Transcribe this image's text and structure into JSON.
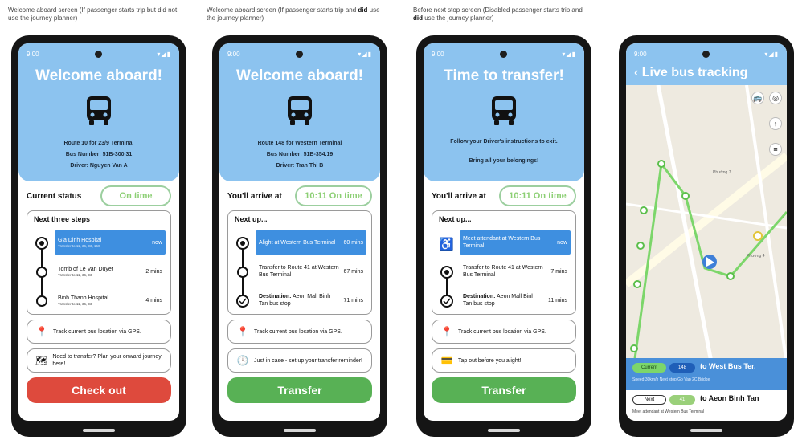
{
  "captions": [
    {
      "pre": "Welcome aboard screen (If passenger starts trip but did ",
      "bold": "",
      "post": "not use the journey planner)"
    },
    {
      "pre": "Welcome aboard screen (If passenger starts trip and ",
      "bold": "did",
      "post": " use the journey planner)"
    },
    {
      "pre": "Before next stop screen (Disabled passenger starts trip and ",
      "bold": "did",
      "post": " use the journey planner)"
    }
  ],
  "status_bar": {
    "time": "9:00",
    "icons": "▾◢▮"
  },
  "screen1": {
    "title": "Welcome aboard!",
    "route": "Route 10 for 23/9 Terminal",
    "bus_number": "Bus Number: 51B-300.31",
    "driver": "Driver: Nguyen Van A",
    "status_label": "Current status",
    "status_value": "On time",
    "card_title": "Next three steps",
    "stops": [
      {
        "name": "Gia Dinh Hospital",
        "sub": "Transfer to 11, 36, 93, 150",
        "eta": "now"
      },
      {
        "name": "Tomb of Le Van Duyet",
        "sub": "Transfer to 11, 36, 93",
        "eta": "2 mins"
      },
      {
        "name": "Binh Thanh Hospital",
        "sub": "Transfer to 11, 36, 93",
        "eta": "4 mins"
      }
    ],
    "track_text": "Track current bus location via GPS.",
    "transfer_text": "Need to transfer? Plan your onward journey here!",
    "checkout_label": "Check out"
  },
  "screen2": {
    "title": "Welcome aboard!",
    "route": "Route 148 for Western Terminal",
    "bus_number": "Bus Number: 51B-354.19",
    "driver": "Driver: Tran Thi B",
    "arrive_label": "You'll arrive at",
    "arrive_value": "10:11 On time",
    "card_title": "Next up...",
    "steps": [
      {
        "name": "Alight at Western Bus Terminal",
        "eta": "60 mins"
      },
      {
        "name": "Transfer to Route 41 at Western Bus Terminal",
        "eta": "67 mins"
      },
      {
        "name_bold": "Destination:",
        "name": " Aeon Mall Binh Tan bus stop",
        "eta": "71 mins"
      }
    ],
    "track_text": "Track current bus location via GPS.",
    "reminder_text": "Just in case - set up your transfer reminder!",
    "button_label": "Transfer"
  },
  "screen3": {
    "title": "Time to transfer!",
    "line1": "Follow your Driver's instructions to exit.",
    "line2": "Bring all your belongings!",
    "arrive_label": "You'll arrive at",
    "arrive_value": "10:11 On time",
    "card_title": "Next up...",
    "steps": [
      {
        "name": "Meet attendant at Western Bus Terminal",
        "eta": "now"
      },
      {
        "name": "Transfer to Route 41 at Western Bus Terminal",
        "eta": "7 mins"
      },
      {
        "name_bold": "Destination:",
        "name": " Aeon Mall Binh Tan bus stop",
        "eta": "11 mins"
      }
    ],
    "track_text": "Track current bus location via GPS.",
    "tap_text": "Tap out before you alight!",
    "button_label": "Transfer"
  },
  "screen4": {
    "title": "Live bus tracking",
    "panel": {
      "current_label": "Current",
      "route": "148",
      "dest": "to West Bus Ter.",
      "sub": "Speed 30km/h Next stop Go Vap 2C Bridge"
    },
    "next": {
      "label": "Next",
      "route": "41",
      "dest": "to Aeon Binh Tan",
      "sub": "Meet attendant at Western Bus Terminal"
    },
    "map_labels": [
      "Phường 7",
      "Phường 4"
    ]
  },
  "colors": {
    "header_blue": "#8cc3ef",
    "highlight_blue": "#3e8fe0",
    "ok_green": "#8ccf74",
    "checkout_red": "#de4a3d",
    "transfer_green": "#58b155"
  }
}
